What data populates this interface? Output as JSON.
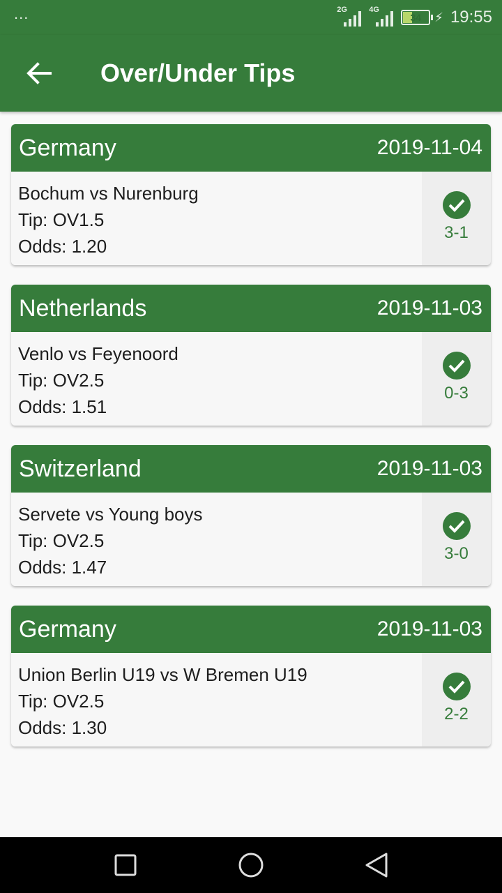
{
  "status_bar": {
    "dots": "...",
    "network_1": "2G",
    "network_2": "4G",
    "battery": "34",
    "time": "19:55"
  },
  "app_bar": {
    "back_icon": "arrow-back-icon",
    "title": "Over/Under Tips"
  },
  "tips": [
    {
      "country": "Germany",
      "date": "2019-11-04",
      "match": "Bochum vs Nurenburg",
      "tip": "Tip: OV1.5",
      "odds": "Odds: 1.20",
      "result_icon": "check-circle-icon",
      "score": "3-1"
    },
    {
      "country": "Netherlands",
      "date": "2019-11-03",
      "match": "Venlo vs Feyenoord",
      "tip": "Tip: OV2.5",
      "odds": "Odds: 1.51",
      "result_icon": "check-circle-icon",
      "score": "0-3"
    },
    {
      "country": "Switzerland",
      "date": "2019-11-03",
      "match": "Servete vs Young boys",
      "tip": "Tip: OV2.5",
      "odds": "Odds: 1.47",
      "result_icon": "check-circle-icon",
      "score": "3-0"
    },
    {
      "country": "Germany",
      "date": "2019-11-03",
      "match": "Union Berlin U19 vs W Bremen U19",
      "tip": "Tip: OV2.5",
      "odds": "Odds: 1.30",
      "result_icon": "check-circle-icon",
      "score": "2-2"
    }
  ],
  "colors": {
    "primary": "#367c3b",
    "background": "#f9f9f9"
  }
}
